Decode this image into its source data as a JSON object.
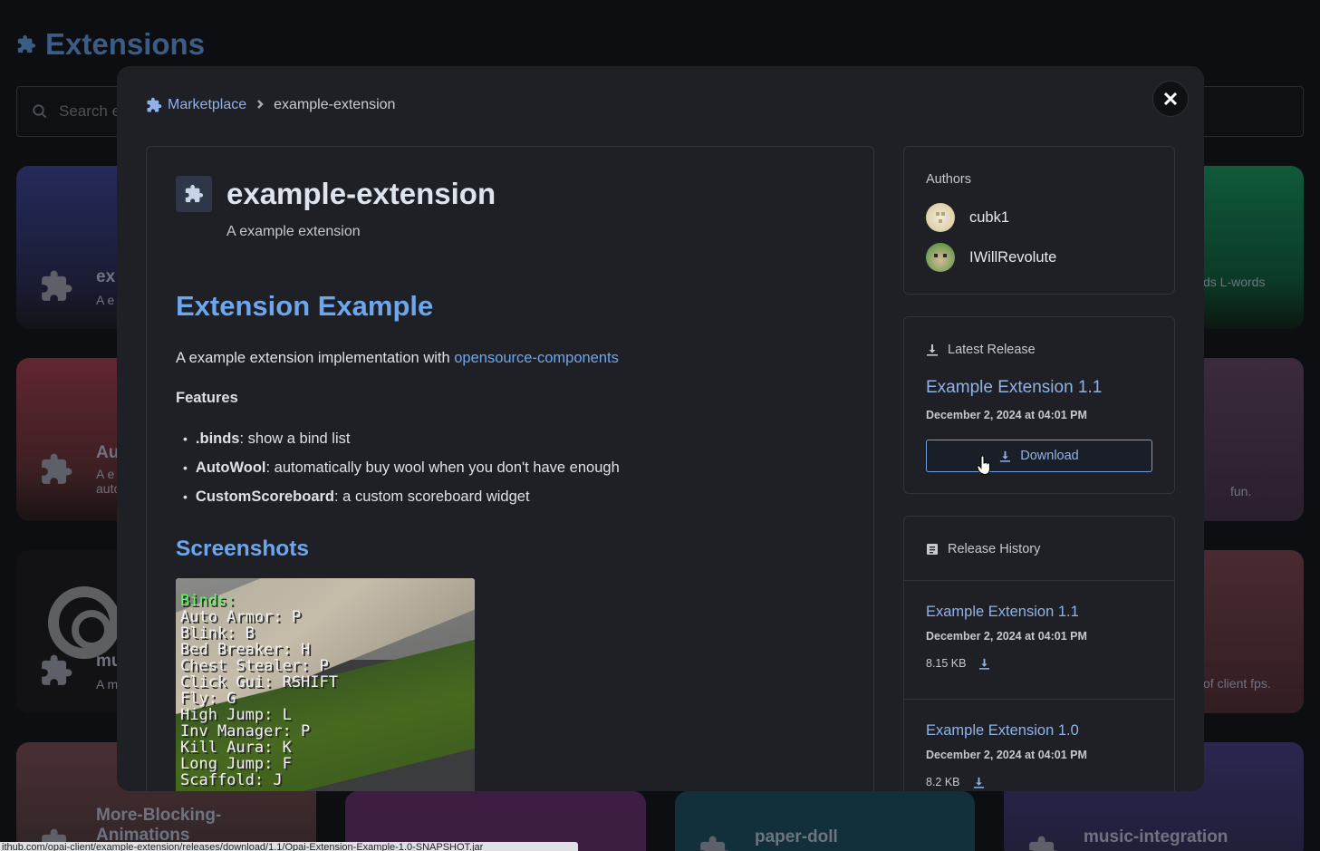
{
  "background": {
    "title": "Extensions",
    "search_placeholder": "Search e",
    "cards": [
      {
        "title": "ex",
        "desc": "A e"
      },
      {
        "title": "Au",
        "desc": "A e\nauto"
      },
      {
        "title": "mu",
        "desc": "A m"
      },
      {
        "title": "More-Blocking-\nAnimations",
        "desc": ""
      },
      {
        "title": "paper-doll",
        "desc": ""
      },
      {
        "title": "music-integration",
        "desc": ""
      }
    ],
    "right_cards": [
      {
        "desc": "ds L-words"
      },
      {
        "desc": "fun."
      },
      {
        "desc": "of client fps."
      }
    ],
    "status_url": "ithub.com/opai-client/example-extension/releases/download/1.1/Opai-Extension-Example-1.0-SNAPSHOT.jar"
  },
  "modal": {
    "breadcrumb": {
      "root": "Marketplace",
      "current": "example-extension"
    },
    "extension": {
      "name": "example-extension",
      "description": "A example extension"
    },
    "readme": {
      "h1": "Extension Example",
      "intro": "A example extension implementation with ",
      "intro_link": "opensource-components",
      "features_heading": "Features",
      "features": [
        {
          "name": ".binds",
          "text": ": show a bind list"
        },
        {
          "name": "AutoWool",
          "text": ": automatically buy wool when you don't have enough"
        },
        {
          "name": "CustomScoreboard",
          "text": ": a custom scoreboard widget"
        }
      ],
      "screenshots_heading": "Screenshots",
      "screenshot_lines": [
        "Binds:",
        "Auto Armor: P",
        "Blink: B",
        "Bed Breaker: H",
        "Chest Stealer: P",
        "Click Gui: RSHIFT",
        "Fly: G",
        "High Jump: L",
        "Inv Manager: P",
        "Kill Aura: K",
        "Long Jump: F",
        "Scaffold: J"
      ]
    },
    "authors": {
      "label": "Authors",
      "list": [
        {
          "name": "cubk1"
        },
        {
          "name": "IWillRevolute"
        }
      ]
    },
    "latest_release": {
      "label": "Latest Release",
      "name": "Example Extension 1.1",
      "date": "December 2, 2024 at 04:01 PM",
      "download_label": "Download"
    },
    "release_history": {
      "label": "Release History",
      "items": [
        {
          "name": "Example Extension 1.1",
          "date": "December 2, 2024 at 04:01 PM",
          "size": "8.15 KB"
        },
        {
          "name": "Example Extension 1.0",
          "date": "December 2, 2024 at 04:01 PM",
          "size": "8.2 KB"
        }
      ]
    }
  },
  "colors": {
    "accent": "#6ea6ee",
    "link": "#8fb3e8",
    "modal_bg": "#1e2025",
    "page_bg": "#0d0e11"
  }
}
